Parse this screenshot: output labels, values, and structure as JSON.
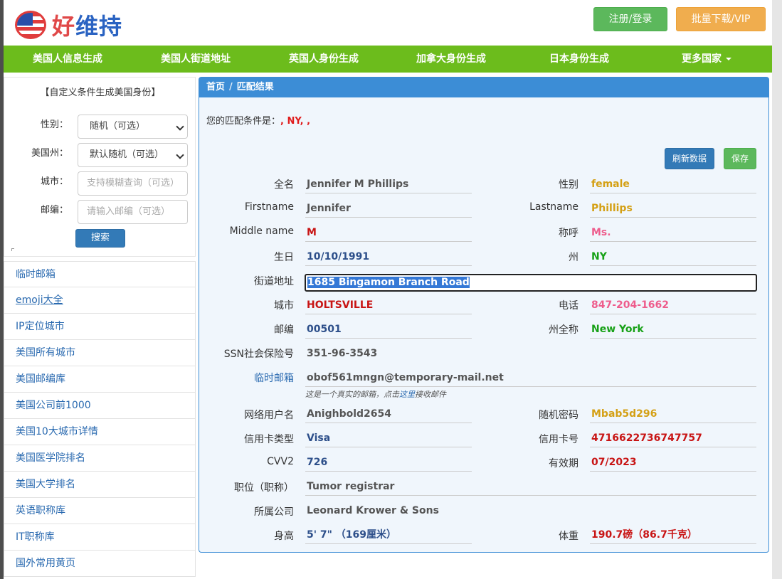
{
  "logo": {
    "text_a": "好",
    "text_b": "维持"
  },
  "header": {
    "register_label": "注册/登录",
    "vip_label": "批量下载/VIP"
  },
  "nav": [
    "美国人信息生成",
    "美国人街道地址",
    "英国人身份生成",
    "加拿大身份生成",
    "日本身份生成",
    "更多国家"
  ],
  "sidebar": {
    "title": "【自定义条件生成美国身份】",
    "gender_label": "性别：",
    "gender_value": "随机（可选）",
    "state_label": "美国州：",
    "state_value": "默认随机（可选）",
    "city_label": "城市：",
    "city_placeholder": "支持模糊查询（可选）",
    "zip_label": "邮编：",
    "zip_placeholder": "请输入邮编（可选）",
    "search_label": "搜索",
    "links": [
      "临时邮箱",
      "emoji大全",
      "IP定位城市",
      "美国所有城市",
      "美国邮编库",
      "美国公司前1000",
      "美国10大城市详情",
      "美国医学院排名",
      "美国大学排名",
      "英语职称库",
      "IT职称库",
      "国外常用黄页"
    ]
  },
  "panel": {
    "breadcrumb_home": "首页",
    "breadcrumb_sep": "/",
    "breadcrumb_current": "匹配结果",
    "condition_label": "您的匹配条件是：",
    "condition_value": ", NY, ,",
    "refresh_label": "刷新数据",
    "save_label": "保存"
  },
  "profile": {
    "fullname_label": "全名",
    "fullname": "Jennifer M Phillips",
    "gender_label": "性别",
    "gender": "female",
    "firstname_label": "Firstname",
    "firstname": "Jennifer",
    "lastname_label": "Lastname",
    "lastname": "Phillips",
    "middlename_label": "Middle name",
    "middlename": "M",
    "title_label": "称呼",
    "title": "Ms.",
    "birthday_label": "生日",
    "birthday": "10/10/1991",
    "state_label": "州",
    "state": "NY",
    "street_label": "街道地址",
    "street": "1685 Bingamon Branch Road",
    "city_label": "城市",
    "city": "HOLTSVILLE",
    "phone_label": "电话",
    "phone": "847-204-1662",
    "zip_label": "邮编",
    "zip": "00501",
    "state_full_label": "州全称",
    "state_full": "New York",
    "ssn_label": "SSN社会保险号",
    "ssn": "351-96-3543",
    "email_label": "临时邮箱",
    "email": "obof561mngn@temporary-mail.net",
    "email_note_pre": "这是一个真实的邮箱，点击",
    "email_note_link": "这里",
    "email_note_post": "接收邮件",
    "username_label": "网络用户名",
    "username": "Anighbold2654",
    "password_label": "随机密码",
    "password": "Mbab5d296",
    "cc_type_label": "信用卡类型",
    "cc_type": "Visa",
    "cc_number_label": "信用卡号",
    "cc_number": "4716622736747757",
    "cvv_label": "CVV2",
    "cvv": "726",
    "expiry_label": "有效期",
    "expiry": "07/2023",
    "job_label": "职位（职称）",
    "job": "Tumor registrar",
    "company_label": "所属公司",
    "company": "Leonard Krower & Sons",
    "height_label": "身高",
    "height": "5' 7\"  （169厘米）",
    "weight_label": "体重",
    "weight": "190.7磅（86.7千克）"
  },
  "colors": {
    "nav_green": "#6cbc1c",
    "panel_blue": "#3c8dd6",
    "highlight_red": "#c81414"
  }
}
